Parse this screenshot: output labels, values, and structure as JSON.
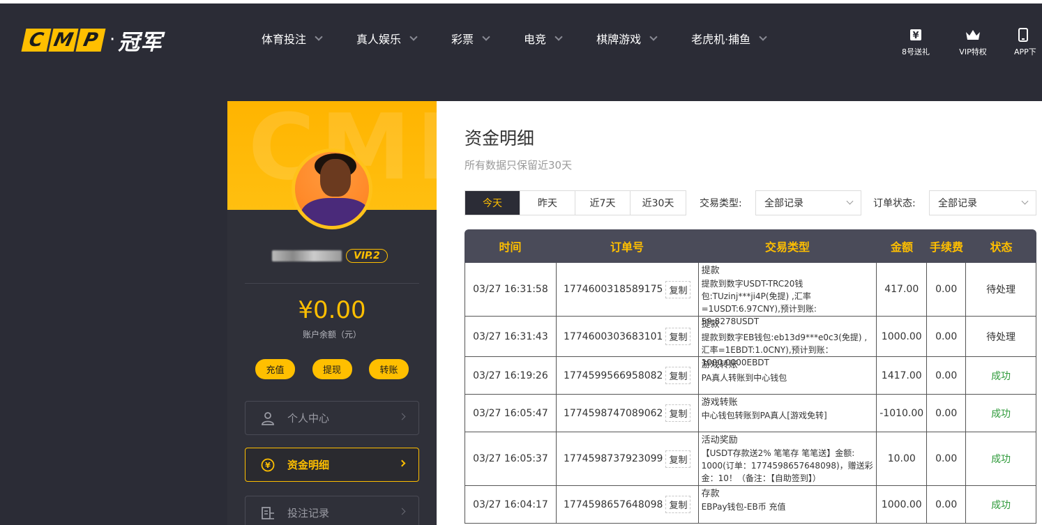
{
  "header": {
    "logo_letters": [
      "C",
      "M",
      "P"
    ],
    "logo_cn": "冠军",
    "nav": [
      {
        "label": "体育投注"
      },
      {
        "label": "真人娱乐"
      },
      {
        "label": "彩票"
      },
      {
        "label": "电竞"
      },
      {
        "label": "棋牌游戏"
      },
      {
        "label": "老虎机·捕鱼"
      }
    ],
    "right_icons": [
      {
        "label": "8号送礼",
        "icon": "yen-gift-icon"
      },
      {
        "label": "VIP特权",
        "icon": "crown-icon"
      },
      {
        "label": "APP下",
        "icon": "phone-icon"
      }
    ]
  },
  "profile": {
    "banner_text": "CMP",
    "vip": "VIP.2",
    "balance": "¥0.00",
    "balance_label": "账户余额（元）",
    "actions": [
      "充值",
      "提现",
      "转账"
    ],
    "menu": [
      {
        "label": "个人中心",
        "icon": "user-icon"
      },
      {
        "label": "资金明细",
        "icon": "yen-circle-icon"
      },
      {
        "label": "投注记录",
        "icon": "record-icon"
      }
    ]
  },
  "main": {
    "title": "资金明细",
    "subtitle": "所有数据只保留近30天",
    "tabs": [
      "今天",
      "昨天",
      "近7天",
      "近30天"
    ],
    "filters": {
      "type_label": "交易类型:",
      "type_value": "全部记录",
      "status_label": "订单状态:",
      "status_value": "全部记录"
    },
    "columns": [
      "时间",
      "订单号",
      "交易类型",
      "金额",
      "手续费",
      "状态"
    ],
    "copy_label": "复制",
    "rows": [
      {
        "time": "03/27 16:31:58",
        "order": "1774600318589175",
        "type_title": "提款",
        "type_desc": "提款到数字USDT-TRC20钱包:TUzinj***ji4P(免提) ,汇率=1USDT:6.97CNY),预计到账: 59.8278USDT",
        "amount": "417.00",
        "fee": "0.00",
        "status": "待处理",
        "ok": false
      },
      {
        "time": "03/27 16:31:43",
        "order": "1774600303683101",
        "type_title": "提款",
        "type_desc": "提款到数字EB钱包:eb13d9***e0c3(免提) ,汇率=1EBDT:1.0CNY),预计到账：1000.0000EBDT",
        "amount": "1000.00",
        "fee": "0.00",
        "status": "待处理",
        "ok": false
      },
      {
        "time": "03/27 16:19:26",
        "order": "1774599566958082",
        "type_title": "游戏转账",
        "type_desc": "PA真人转账到中心钱包",
        "amount": "1417.00",
        "fee": "0.00",
        "status": "成功",
        "ok": true
      },
      {
        "time": "03/27 16:05:47",
        "order": "1774598747089062",
        "type_title": "游戏转账",
        "type_desc": "中心钱包转账到PA真人[游戏免转]",
        "amount": "-1010.00",
        "fee": "0.00",
        "status": "成功",
        "ok": true
      },
      {
        "time": "03/27 16:05:37",
        "order": "1774598737923099",
        "type_title": "活动奖励",
        "type_desc": "【USDT存款送2% 笔笔存 笔笔送】金额: 1000(订单：1774598657648098)，赠送彩金：10！（备注：【自助签到】）",
        "amount": "10.00",
        "fee": "0.00",
        "status": "成功",
        "ok": true
      },
      {
        "time": "03/27 16:04:17",
        "order": "1774598657648098",
        "type_title": "存款",
        "type_desc": "EBPay钱包-EB币 充值",
        "amount": "1000.00",
        "fee": "0.00",
        "status": "成功",
        "ok": true
      }
    ]
  },
  "colors": {
    "accent": "#ffbf00",
    "dark_bg": "#2b2c36",
    "success": "#2e9a3a"
  }
}
